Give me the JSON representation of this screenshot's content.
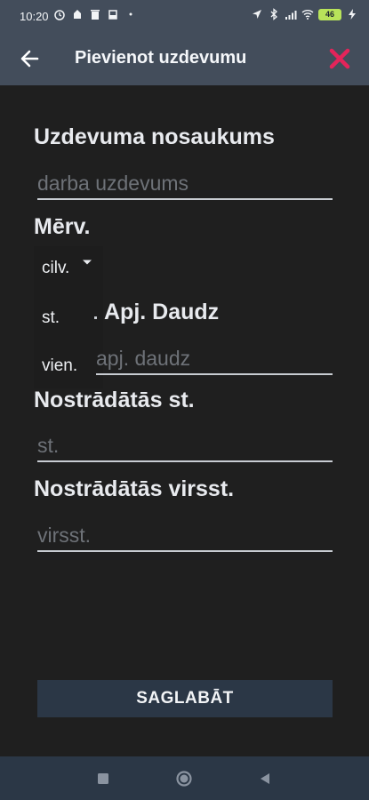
{
  "status_bar": {
    "time": "10:20",
    "battery": "46"
  },
  "app_bar": {
    "title": "Pievienot uzdevumu"
  },
  "form": {
    "task_name": {
      "label": "Uzdevuma nosaukums",
      "placeholder": "darba uzdevums",
      "value": ""
    },
    "unit": {
      "label": "Mērv.",
      "options": [
        "cilv.",
        "st.",
        "vien."
      ]
    },
    "quantity": {
      "label": "Apj. Daudz",
      "placeholder": "apj. daudz",
      "value": ""
    },
    "hours": {
      "label": "Nostrādātās st.",
      "placeholder": "st.",
      "value": ""
    },
    "overtime": {
      "label": "Nostrādātās virsst.",
      "placeholder": "virsst.",
      "value": ""
    },
    "save_label": "SAGLABĀT"
  },
  "colors": {
    "bar": "#434d5b",
    "background": "#1f1f1f",
    "button": "#2b3746",
    "close_accent": "#e3245a"
  }
}
